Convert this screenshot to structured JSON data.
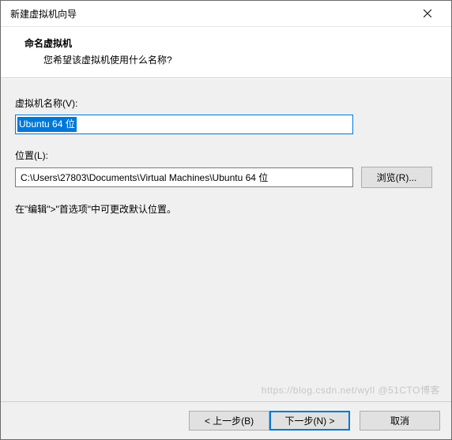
{
  "titlebar": {
    "title": "新建虚拟机向导"
  },
  "header": {
    "title": "命名虚拟机",
    "subtitle": "您希望该虚拟机使用什么名称?"
  },
  "fields": {
    "name_label": "虚拟机名称(V):",
    "name_value": "Ubuntu 64 位",
    "location_label": "位置(L):",
    "location_value": "C:\\Users\\27803\\Documents\\Virtual Machines\\Ubuntu 64 位",
    "browse_label": "浏览(R)..."
  },
  "hint": "在\"编辑\">\"首选项\"中可更改默认位置。",
  "footer": {
    "back": "< 上一步(B)",
    "next": "下一步(N) >",
    "cancel": "取消"
  },
  "watermark": "https://blog.csdn.net/wyll @51CTO博客"
}
